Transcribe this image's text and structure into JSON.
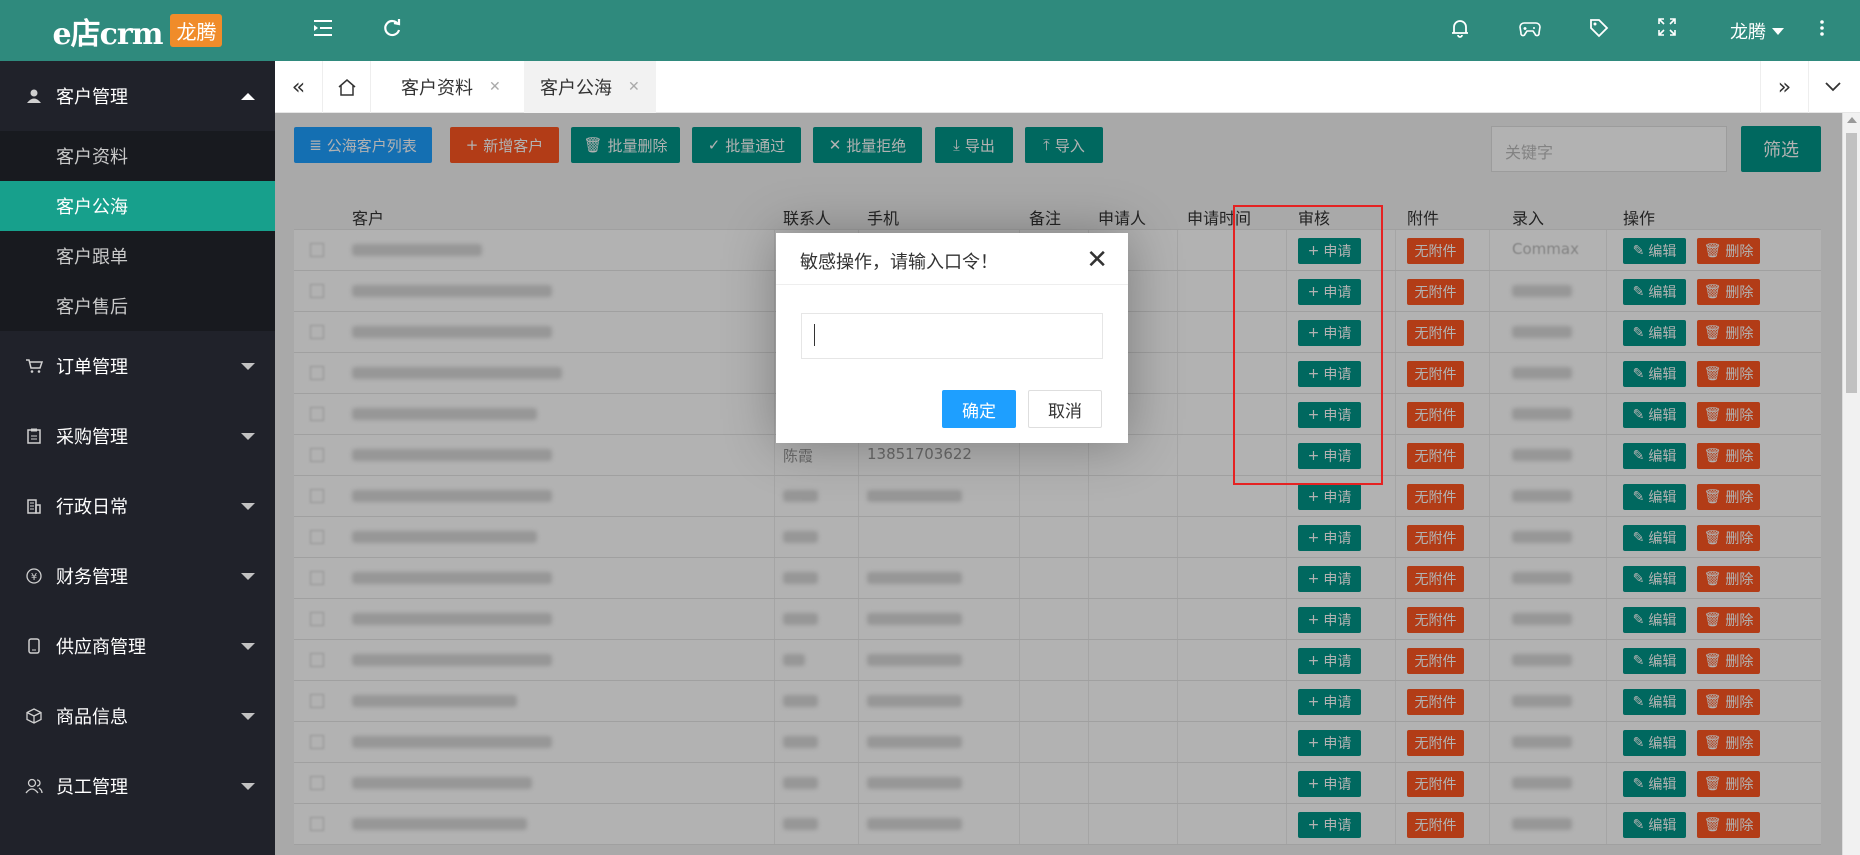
{
  "logo": {
    "text": "e店crm",
    "badge": "龙腾"
  },
  "sidebar": {
    "groups": [
      {
        "label": "客户管理",
        "icon": "user-icon",
        "expanded": true,
        "items": [
          {
            "label": "客户资料",
            "active": false
          },
          {
            "label": "客户公海",
            "active": true
          },
          {
            "label": "客户跟单",
            "active": false
          },
          {
            "label": "客户售后",
            "active": false
          }
        ]
      },
      {
        "label": "订单管理",
        "icon": "cart-icon"
      },
      {
        "label": "采购管理",
        "icon": "clipboard-icon"
      },
      {
        "label": "行政日常",
        "icon": "building-icon"
      },
      {
        "label": "财务管理",
        "icon": "yen-icon"
      },
      {
        "label": "供应商管理",
        "icon": "phone-icon"
      },
      {
        "label": "商品信息",
        "icon": "box-icon"
      },
      {
        "label": "员工管理",
        "icon": "users-icon"
      }
    ]
  },
  "header": {
    "user": "龙腾"
  },
  "tabs": [
    {
      "label": "客户资料",
      "active": false
    },
    {
      "label": "客户公海",
      "active": true
    }
  ],
  "toolbar": {
    "list_btn": "公海客户列表",
    "add_btn": "新增客户",
    "batch_delete": "批量删除",
    "batch_approve": "批量通过",
    "batch_reject": "批量拒绝",
    "export": "导出",
    "import": "导入",
    "search_placeholder": "关键字",
    "filter": "筛选"
  },
  "table": {
    "headers": [
      "客户",
      "联系人",
      "手机",
      "备注",
      "申请人",
      "申请时间",
      "审核",
      "附件",
      "录入",
      "操作"
    ],
    "row_buttons": {
      "apply": "申请",
      "attach": "无附件",
      "edit": "编辑",
      "delete": "删除"
    },
    "visible_contact": "陈霞",
    "visible_phone": "13851703622",
    "visible_recorder": "Commax",
    "row_count": 15
  },
  "dialog": {
    "title": "敏感操作，请输入口令！",
    "ok": "确定",
    "cancel": "取消"
  },
  "colors": {
    "primary": "#009688",
    "header": "#2f8a7d",
    "sidebar": "#20222a",
    "danger": "#ff5722",
    "blue": "#1e9fff"
  }
}
